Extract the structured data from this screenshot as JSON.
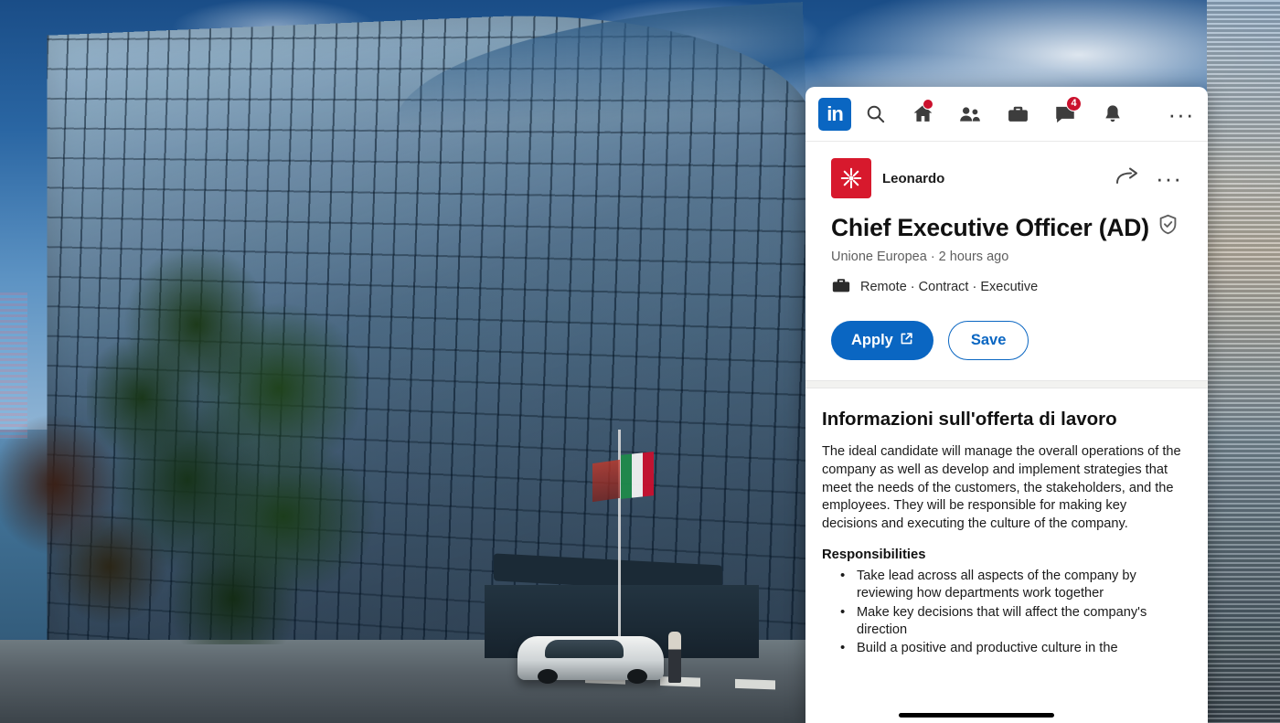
{
  "nav": {
    "logo_text": "in",
    "items": [
      {
        "name": "search-icon",
        "label": "Search",
        "badge": null
      },
      {
        "name": "home-icon",
        "label": "Home",
        "badge": "dot"
      },
      {
        "name": "my-network-icon",
        "label": "My Network",
        "badge": null
      },
      {
        "name": "jobs-icon",
        "label": "Jobs",
        "badge": null
      },
      {
        "name": "messaging-icon",
        "label": "Messaging",
        "badge": "4"
      },
      {
        "name": "notifications-icon",
        "label": "Notifications",
        "badge": null
      }
    ],
    "more_label": "···"
  },
  "job": {
    "company": "Leonardo",
    "title": "Chief Executive Officer (AD)",
    "verified": true,
    "location_posted": "Unione Europea · 2 hours ago",
    "employment_details": "Remote · Contract · Executive",
    "apply_label": "Apply",
    "save_label": "Save",
    "share_icon": "share-arrow-icon",
    "overflow_icon": "more-options-icon"
  },
  "description": {
    "heading": "Informazioni sull'offerta di lavoro",
    "paragraph": "The ideal candidate will manage the overall operations of the company as well as develop and implement strategies that meet the needs of the customers, the stakeholders, and the employees. They will be responsible for making key decisions and executing the culture of the company.",
    "responsibilities_title": "Responsibilities",
    "responsibilities": [
      "Take lead across all aspects of the company by reviewing how departments work together",
      "Make key decisions that will affect the company's direction",
      "Build a positive and productive culture in the"
    ]
  },
  "colors": {
    "linkedin_blue": "#0a66c2",
    "badge_red": "#cb112d",
    "company_red": "#d7192d"
  }
}
